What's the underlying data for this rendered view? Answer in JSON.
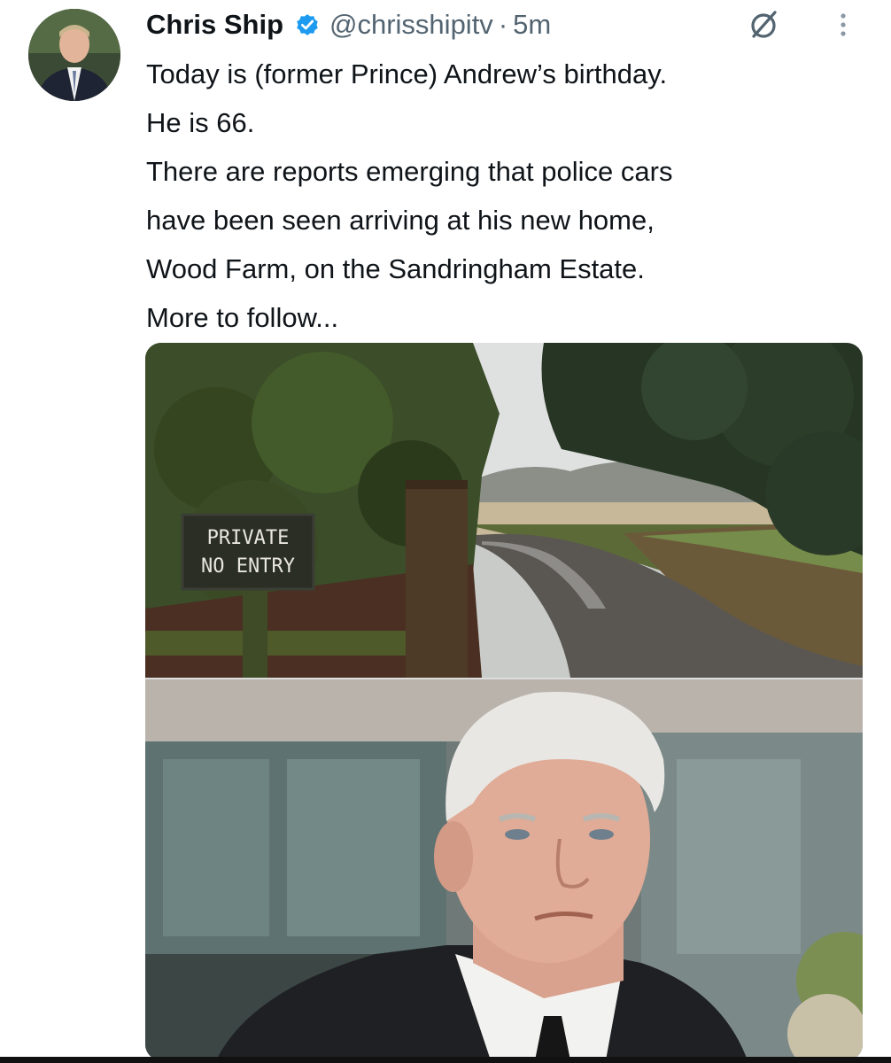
{
  "tweet": {
    "author_name": "Chris Ship",
    "handle": "@chrisshipitv",
    "separator": "·",
    "time": "5m",
    "lines": [
      "Today is (former Prince) Andrew’s birthday.",
      "He is 66.",
      "There are reports emerging that police cars",
      "have been seen arriving at his new home,",
      "Wood Farm, on the Sandringham Estate.",
      "More to follow..."
    ]
  },
  "media": {
    "sign_line1": "PRIVATE",
    "sign_line2": "NO ENTRY"
  },
  "icons": {
    "verified": "verified-badge-icon",
    "grok": "grok-icon",
    "more": "more-options-icon"
  },
  "colors": {
    "verified_blue": "#1d9bf0",
    "text_primary": "#0f1419",
    "text_secondary": "#536471"
  }
}
